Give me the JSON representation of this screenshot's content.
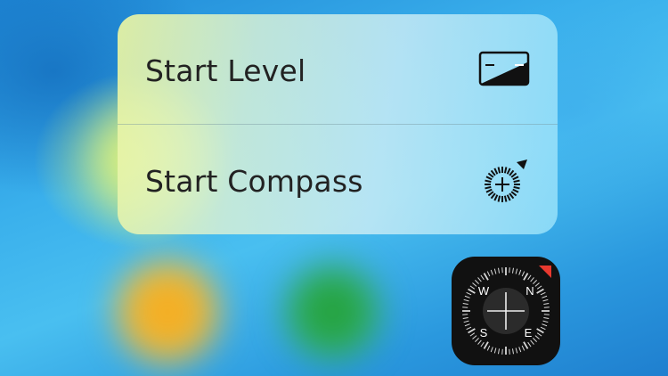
{
  "quick_actions": {
    "items": [
      {
        "label": "Start Level",
        "icon": "level-icon"
      },
      {
        "label": "Start Compass",
        "icon": "compass-dial-icon"
      }
    ]
  },
  "compass_app_icon": {
    "icon": "compass-app-icon",
    "cardinals": {
      "north": "N",
      "south": "S",
      "east": "E",
      "west": "W"
    },
    "accent_color": "#e8392f"
  },
  "background_apps": [
    {
      "icon": "blurred-app-icon-orange",
      "color": "#f4a51e"
    },
    {
      "icon": "blurred-app-icon-green",
      "color": "#2bab48"
    }
  ]
}
